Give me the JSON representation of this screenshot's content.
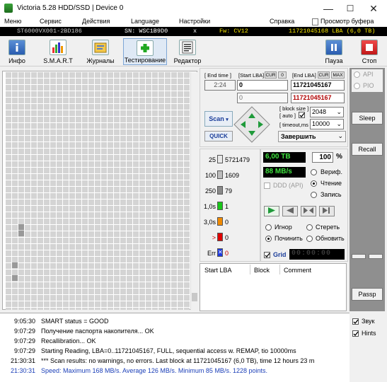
{
  "window": {
    "title": "Victoria 5.28 HDD/SSD | Device 0",
    "minimize": "—",
    "maximize": "☐",
    "close": "✕"
  },
  "menu": {
    "items": [
      "Меню",
      "Сервис",
      "Действия",
      "Language",
      "Настройки",
      "Справка"
    ],
    "clipboard": "Просмотр буфера"
  },
  "device": {
    "model": "ST6000VX001-2BD186",
    "serial": "SN: WSC1B9D0",
    "x": "x",
    "firmware": "Fw: CV12",
    "capacity": "11721045168 LBA (6,0 TB)"
  },
  "toolbar": {
    "buttons": [
      {
        "label": "Инфо",
        "icon": "info-icon"
      },
      {
        "label": "S.M.A.R.T",
        "icon": "smart-chart-icon"
      },
      {
        "label": "Журналы",
        "icon": "journals-icon"
      },
      {
        "label": "Тестирование",
        "icon": "testing-icon"
      },
      {
        "label": "Редактор",
        "icon": "editor-icon"
      }
    ],
    "pause": "Пауза",
    "stop": "Стоп"
  },
  "controls": {
    "end_time_label": "[ End time ]",
    "end_time": "2:24",
    "start_lba_label": "[Start LBA]",
    "cur": "CUR",
    "zero_pill": "0",
    "start_lba": "0",
    "start_lba2": "0",
    "end_lba_label": "[End LBA]",
    "cur2": "CUR",
    "max": "MAX",
    "end_lba": "11721045167",
    "end_lba2": "11721045167",
    "block_size_label": "[ block size ]",
    "auto_label": "[ auto ]",
    "block_size": "2048",
    "timeout_label": "[ timeout,ms ]",
    "timeout": "10000",
    "scan": "Scan",
    "quick": "QUICK",
    "finish": "Завершить"
  },
  "stats": [
    {
      "label": "25",
      "value": "5721479",
      "color": "#e8e8e8"
    },
    {
      "label": "100",
      "value": "1609",
      "color": "#bdbdbd"
    },
    {
      "label": "250",
      "value": "79",
      "color": "#8a8a8a"
    },
    {
      "label": "1,0s",
      "value": "1",
      "color": "#19c619"
    },
    {
      "label": "3,0s",
      "value": "0",
      "color": "#f08a00"
    },
    {
      "label": ">",
      "value": "0",
      "color": "#e00000"
    },
    {
      "label": "Err",
      "value": "0",
      "color": "#1f3ae0"
    }
  ],
  "status": {
    "size": "6,00 TB",
    "percent": "100",
    "percent_sign": "%",
    "speed": "88 MB/s",
    "verify": "Вериф.",
    "read": "Чтение",
    "write": "Запись",
    "ddd": "DDD (API)",
    "ignore": "Игнор",
    "erase": "Стереть",
    "repair": "Починить",
    "refresh": "Обновить",
    "grid": "Grid",
    "timer": "00:00:00"
  },
  "defects": {
    "col_start": "Start LBA",
    "col_block": "Block",
    "col_comment": "Comment"
  },
  "right": {
    "api": "API",
    "pio": "PIO",
    "sleep": "Sleep",
    "recall": "Recall",
    "passp": "Passp"
  },
  "log": [
    {
      "time": "9:05:30",
      "msg": "SMART status = GOOD",
      "color": "#000000"
    },
    {
      "time": "9:07:29",
      "msg": "Получение паспорта накопителя... OK",
      "color": "#000000"
    },
    {
      "time": "9:07:29",
      "msg": "Recallibration... OK",
      "color": "#000000"
    },
    {
      "time": "9:07:29",
      "msg": "Starting Reading, LBA=0..11721045167, FULL, sequential access w. REMAP, tio 10000ms",
      "color": "#000000"
    },
    {
      "time": "21:30:31",
      "msg": "*** Scan results: no warnings, no errors. Last block at 11721045167 (6,0 TB), time 12 hours 23 m",
      "color": "#000000"
    },
    {
      "time": "21:30:31",
      "msg": "Speed: Maximum 168 MB/s. Average 126 MB/s. Minimum 85 MB/s. 1228 points.",
      "color": "#1b3fb8"
    }
  ],
  "logside": {
    "sound": "Звук",
    "hints": "Hints"
  }
}
